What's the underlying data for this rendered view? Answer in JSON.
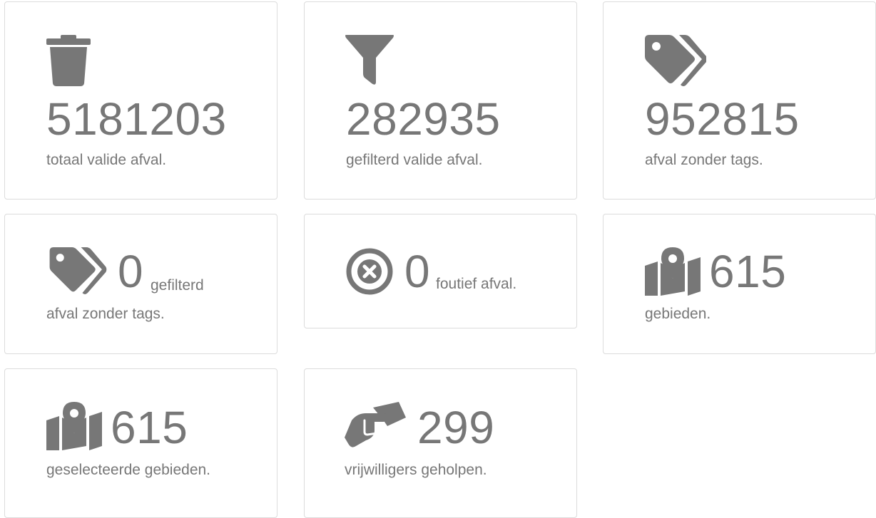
{
  "stats": [
    {
      "value": "5181203",
      "label": "totaal valide afval.",
      "icon": "trash-icon"
    },
    {
      "value": "282935",
      "label": "gefilterd valide afval.",
      "icon": "filter-icon"
    },
    {
      "value": "952815",
      "label": "afval zonder tags.",
      "icon": "tags-icon"
    },
    {
      "value": "0",
      "label_inline": "gefilterd",
      "label": "afval zonder tags.",
      "icon": "tags-icon"
    },
    {
      "value": "0",
      "label_inline": "foutief afval.",
      "icon": "times-circle-icon"
    },
    {
      "value": "615",
      "label": "gebieden.",
      "icon": "map-marked-icon"
    },
    {
      "value": "615",
      "label": "geselecteerde gebieden.",
      "icon": "map-marked-icon"
    },
    {
      "value": "299",
      "label": "vrijwilligers geholpen.",
      "icon": "handshake-icon"
    }
  ],
  "colors": {
    "text": "#777777",
    "border": "#dcdcdc",
    "background": "#ffffff"
  }
}
